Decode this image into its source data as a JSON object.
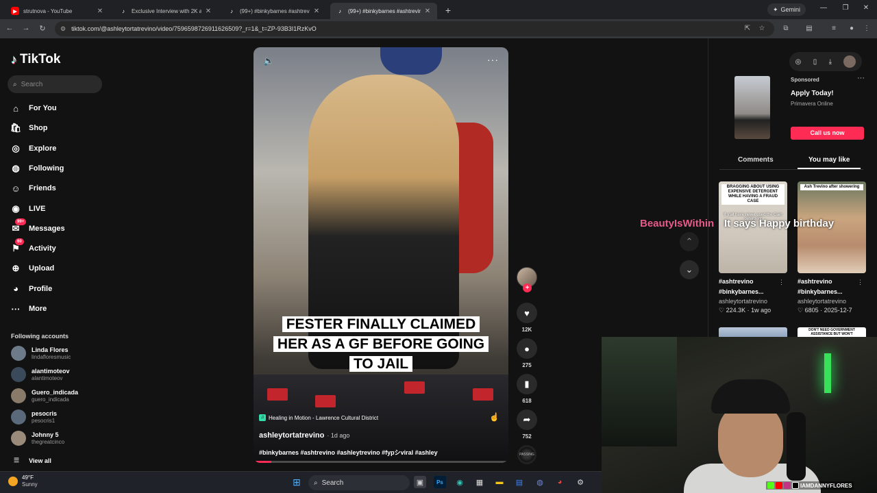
{
  "browser": {
    "tabs": [
      {
        "title": "strutnova - YouTube",
        "icon": "youtube-icon",
        "active": false
      },
      {
        "title": "Exclusive Interview with 2K at TI",
        "icon": "tiktok-icon",
        "active": false
      },
      {
        "title": "(99+) #binkybarnes #ashtrevino",
        "icon": "tiktok-icon",
        "active": false
      },
      {
        "title": "(99+) #binkybarnes #ashtrevino",
        "icon": "tiktok-icon",
        "active": true
      }
    ],
    "new_tab": "+",
    "gemini_label": "Gemini",
    "url": "tiktok.com/@ashleytortatrevino/video/7596598726911626509?_r=1&_t=ZP-93B3I1RzKvO"
  },
  "sidebar": {
    "logo": "TikTok",
    "search_placeholder": "Search",
    "nav": [
      {
        "label": "For You",
        "icon": "home-icon",
        "badge": ""
      },
      {
        "label": "Shop",
        "icon": "shop-icon",
        "badge": ""
      },
      {
        "label": "Explore",
        "icon": "compass-icon",
        "badge": ""
      },
      {
        "label": "Following",
        "icon": "following-icon",
        "badge": ""
      },
      {
        "label": "Friends",
        "icon": "friends-icon",
        "badge": ""
      },
      {
        "label": "LIVE",
        "icon": "live-icon",
        "badge": ""
      },
      {
        "label": "Messages",
        "icon": "messages-icon",
        "badge": "99+"
      },
      {
        "label": "Activity",
        "icon": "activity-icon",
        "badge": "60"
      },
      {
        "label": "Upload",
        "icon": "upload-icon",
        "badge": ""
      },
      {
        "label": "Profile",
        "icon": "profile-icon",
        "badge": ""
      },
      {
        "label": "More",
        "icon": "more-icon",
        "badge": ""
      }
    ],
    "following_title": "Following accounts",
    "following": [
      {
        "name": "Linda Flores",
        "handle": "lindafloresmusic"
      },
      {
        "name": "alantimoteov",
        "handle": "alantimoteov"
      },
      {
        "name": "Guero_indicada",
        "handle": "guero_indicada"
      },
      {
        "name": "pesocris",
        "handle": "pesocris1"
      },
      {
        "name": "Johnny 5",
        "handle": "thegreatcinco"
      }
    ],
    "view_all": "View all"
  },
  "video": {
    "caption": "FESTER FINALLY CLAIMED HER AS A GF BEFORE GOING TO JAIL",
    "music": "Healing in Motion - Lawrence Cultural District",
    "author": "ashleytortatrevino",
    "posted": "· 1d ago",
    "hashtags": "#binkybarnes #ashtrevino #ashleytrevino #fypシviral #ashley",
    "progress": 0.07,
    "actions": {
      "likes": "12K",
      "comments": "275",
      "saves": "618",
      "shares": "752"
    },
    "disc_label": "PASSING"
  },
  "right_panel": {
    "ad": {
      "sponsored": "Sponsored",
      "title": "Apply Today!",
      "advertiser": "Primavera Online",
      "cta": "Call us now"
    },
    "tabs": [
      "Comments",
      "You may like"
    ],
    "active_tab": "You may like",
    "cards": [
      {
        "thumb_text": "BRAGGING ABOUT USING EXPENSIVE DETERGENT WHILE HAVING A FRAUD CASE",
        "thumb_sub": "If y'all have never used the Gain detergent",
        "title": "#ashtrevino #binkybarnes...",
        "user": "ashleytortatrevino",
        "likes": "224.3K",
        "date": "1w ago"
      },
      {
        "thumb_text": "Ash Trevino after showering",
        "thumb_sub": "",
        "title": "#ashtrevino #binkybarnes...",
        "user": "ashleytortatrevino",
        "likes": "6805",
        "date": "2025-12-7"
      }
    ],
    "card_peek_text": "DON'T NEED GOVERNMENT ASSISTANCE BUT WON'T",
    "overlay_user": "BeautyIsWithin",
    "overlay_msg": "It says Happy birthday"
  },
  "stream": {
    "handle": "IAMDANNYFLORES"
  },
  "taskbar": {
    "temp": "49°F",
    "condition": "Sunny",
    "search": "Search"
  },
  "colors": {
    "accent": "#fe2c55",
    "bg": "#121212",
    "chrome_dark": "#202124"
  }
}
